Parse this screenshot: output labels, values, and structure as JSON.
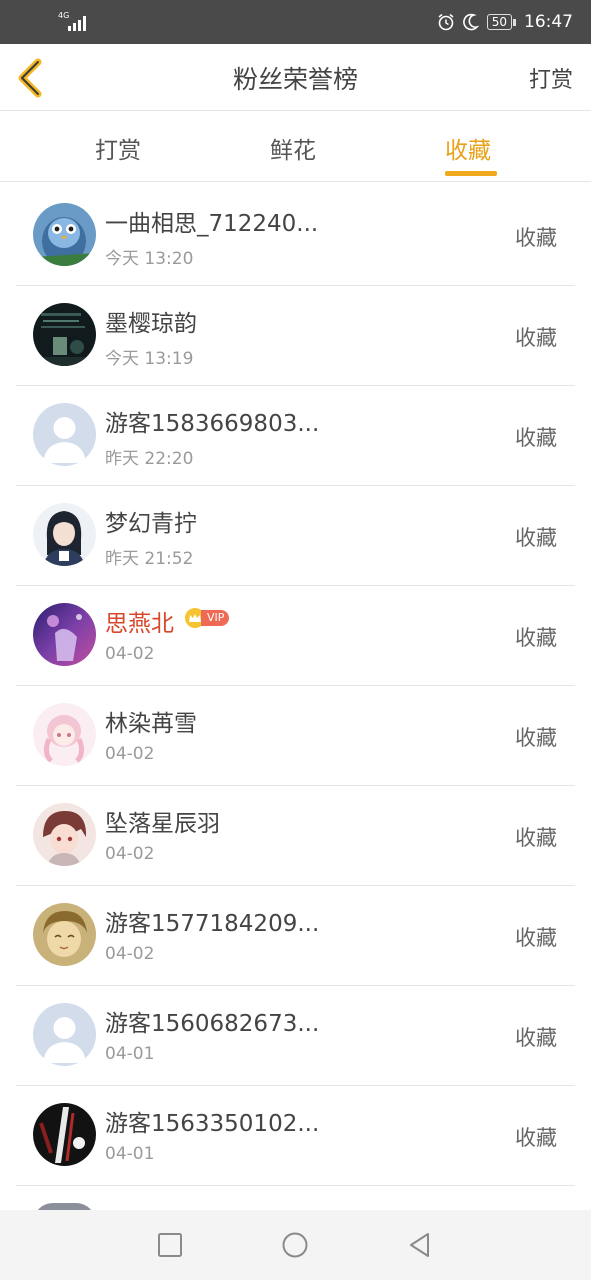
{
  "status_bar": {
    "network": "4G",
    "battery": "50",
    "time": "16:47"
  },
  "header": {
    "title": "粉丝荣誉榜",
    "right_action": "打赏"
  },
  "tabs": [
    {
      "label": "打赏",
      "active": false
    },
    {
      "label": "鲜花",
      "active": false
    },
    {
      "label": "收藏",
      "active": true
    }
  ],
  "accent_color": "#f0a81c",
  "vip_name_color": "#d9472b",
  "fans": [
    {
      "name": "一曲相思_712240...",
      "time": "今天 13:20",
      "action": "收藏"
    },
    {
      "name": "墨樱琼韵",
      "time": "今天 13:19",
      "action": "收藏"
    },
    {
      "name": "游客1583669803...",
      "time": "昨天 22:20",
      "action": "收藏"
    },
    {
      "name": "梦幻青拧",
      "time": "昨天 21:52",
      "action": "收藏"
    },
    {
      "name": "思燕北",
      "time": "04-02",
      "action": "收藏",
      "vip": "VIP"
    },
    {
      "name": "林染苒雪",
      "time": "04-02",
      "action": "收藏"
    },
    {
      "name": "坠落星辰羽",
      "time": "04-02",
      "action": "收藏"
    },
    {
      "name": "游客1577184209...",
      "time": "04-02",
      "action": "收藏"
    },
    {
      "name": "游客1560682673...",
      "time": "04-01",
      "action": "收藏"
    },
    {
      "name": "游客1563350102...",
      "time": "04-01",
      "action": "收藏"
    }
  ]
}
